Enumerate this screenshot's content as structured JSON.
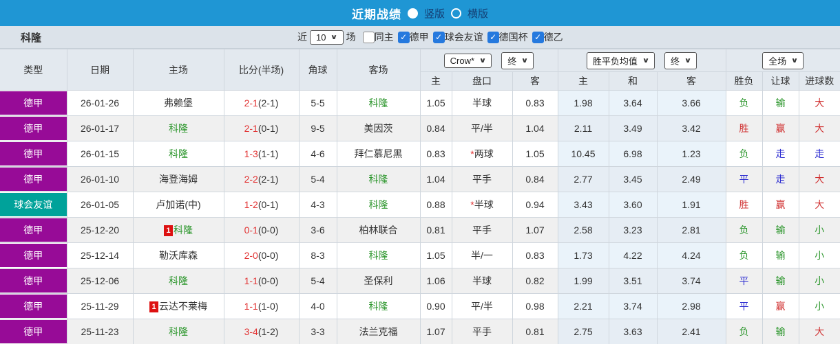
{
  "title_bar": {
    "title": "近期战绩",
    "layout_options": [
      {
        "label": "竖版",
        "selected": true
      },
      {
        "label": "横版",
        "selected": false
      }
    ]
  },
  "team_bar": {
    "team": "科隆",
    "range_prefix": "近",
    "range_value": "10",
    "range_suffix": "场",
    "checkboxes": [
      {
        "label": "同主",
        "checked": false
      },
      {
        "label": "德甲",
        "checked": true
      },
      {
        "label": "球会友谊",
        "checked": true
      },
      {
        "label": "德国杯",
        "checked": true
      },
      {
        "label": "德乙",
        "checked": true
      }
    ]
  },
  "table": {
    "left_columns": [
      "类型",
      "日期",
      "主场",
      "比分(半场)",
      "角球",
      "客场"
    ],
    "selects": {
      "odds_company": "Crow*",
      "odds_state": "终",
      "avg_label": "胜平负均值",
      "avg_state": "终",
      "scope": "全场"
    },
    "sub_columns": [
      "主",
      "盘口",
      "客",
      "主",
      "和",
      "客",
      "胜负",
      "让球",
      "进球数"
    ],
    "rows": [
      {
        "league": "德甲",
        "league_color": "purple",
        "date": "26-01-26",
        "home": {
          "name": "弗赖堡",
          "green": false,
          "card": ""
        },
        "score_ft": "2-1",
        "score_ht": "(2-1)",
        "corner": "5-5",
        "away": {
          "name": "科隆",
          "green": true
        },
        "odds_home": "1.05",
        "handicap": {
          "star": false,
          "text": "半球"
        },
        "odds_away": "0.83",
        "avg": [
          "1.98",
          "3.64",
          "3.66"
        ],
        "results": [
          {
            "text": "负",
            "color": "green"
          },
          {
            "text": "输",
            "color": "green"
          },
          {
            "text": "大",
            "color": "red"
          }
        ]
      },
      {
        "league": "德甲",
        "league_color": "purple",
        "date": "26-01-17",
        "home": {
          "name": "科隆",
          "green": true,
          "card": ""
        },
        "score_ft": "2-1",
        "score_ht": "(0-1)",
        "corner": "9-5",
        "away": {
          "name": "美因茨",
          "green": false
        },
        "odds_home": "0.84",
        "handicap": {
          "star": false,
          "text": "平/半"
        },
        "odds_away": "1.04",
        "avg": [
          "2.11",
          "3.49",
          "3.42"
        ],
        "results": [
          {
            "text": "胜",
            "color": "red"
          },
          {
            "text": "赢",
            "color": "red"
          },
          {
            "text": "大",
            "color": "red"
          }
        ]
      },
      {
        "league": "德甲",
        "league_color": "purple",
        "date": "26-01-15",
        "home": {
          "name": "科隆",
          "green": true,
          "card": ""
        },
        "score_ft": "1-3",
        "score_ht": "(1-1)",
        "corner": "4-6",
        "away": {
          "name": "拜仁慕尼黑",
          "green": false
        },
        "odds_home": "0.83",
        "handicap": {
          "star": true,
          "text": "两球"
        },
        "odds_away": "1.05",
        "avg": [
          "10.45",
          "6.98",
          "1.23"
        ],
        "results": [
          {
            "text": "负",
            "color": "green"
          },
          {
            "text": "走",
            "color": "blue"
          },
          {
            "text": "走",
            "color": "blue"
          }
        ]
      },
      {
        "league": "德甲",
        "league_color": "purple",
        "date": "26-01-10",
        "home": {
          "name": "海登海姆",
          "green": false,
          "card": ""
        },
        "score_ft": "2-2",
        "score_ht": "(2-1)",
        "corner": "5-4",
        "away": {
          "name": "科隆",
          "green": true
        },
        "odds_home": "1.04",
        "handicap": {
          "star": false,
          "text": "平手"
        },
        "odds_away": "0.84",
        "avg": [
          "2.77",
          "3.45",
          "2.49"
        ],
        "results": [
          {
            "text": "平",
            "color": "blue"
          },
          {
            "text": "走",
            "color": "blue"
          },
          {
            "text": "大",
            "color": "red"
          }
        ]
      },
      {
        "league": "球会友谊",
        "league_color": "teal",
        "date": "26-01-05",
        "home": {
          "name": "卢加诺(中)",
          "green": false,
          "card": ""
        },
        "score_ft": "1-2",
        "score_ht": "(0-1)",
        "corner": "4-3",
        "away": {
          "name": "科隆",
          "green": true
        },
        "odds_home": "0.88",
        "handicap": {
          "star": true,
          "text": "半球"
        },
        "odds_away": "0.94",
        "avg": [
          "3.43",
          "3.60",
          "1.91"
        ],
        "results": [
          {
            "text": "胜",
            "color": "red"
          },
          {
            "text": "赢",
            "color": "red"
          },
          {
            "text": "大",
            "color": "red"
          }
        ]
      },
      {
        "league": "德甲",
        "league_color": "purple",
        "date": "25-12-20",
        "home": {
          "name": "科隆",
          "green": true,
          "card": "1"
        },
        "score_ft": "0-1",
        "score_ht": "(0-0)",
        "corner": "3-6",
        "away": {
          "name": "柏林联合",
          "green": false
        },
        "odds_home": "0.81",
        "handicap": {
          "star": false,
          "text": "平手"
        },
        "odds_away": "1.07",
        "avg": [
          "2.58",
          "3.23",
          "2.81"
        ],
        "results": [
          {
            "text": "负",
            "color": "green"
          },
          {
            "text": "输",
            "color": "green"
          },
          {
            "text": "小",
            "color": "green"
          }
        ]
      },
      {
        "league": "德甲",
        "league_color": "purple",
        "date": "25-12-14",
        "home": {
          "name": "勒沃库森",
          "green": false,
          "card": ""
        },
        "score_ft": "2-0",
        "score_ht": "(0-0)",
        "corner": "8-3",
        "away": {
          "name": "科隆",
          "green": true
        },
        "odds_home": "1.05",
        "handicap": {
          "star": false,
          "text": "半/一"
        },
        "odds_away": "0.83",
        "avg": [
          "1.73",
          "4.22",
          "4.24"
        ],
        "results": [
          {
            "text": "负",
            "color": "green"
          },
          {
            "text": "输",
            "color": "green"
          },
          {
            "text": "小",
            "color": "green"
          }
        ]
      },
      {
        "league": "德甲",
        "league_color": "purple",
        "date": "25-12-06",
        "home": {
          "name": "科隆",
          "green": true,
          "card": ""
        },
        "score_ft": "1-1",
        "score_ht": "(0-0)",
        "corner": "5-4",
        "away": {
          "name": "圣保利",
          "green": false
        },
        "odds_home": "1.06",
        "handicap": {
          "star": false,
          "text": "半球"
        },
        "odds_away": "0.82",
        "avg": [
          "1.99",
          "3.51",
          "3.74"
        ],
        "results": [
          {
            "text": "平",
            "color": "blue"
          },
          {
            "text": "输",
            "color": "green"
          },
          {
            "text": "小",
            "color": "green"
          }
        ]
      },
      {
        "league": "德甲",
        "league_color": "purple",
        "date": "25-11-29",
        "home": {
          "name": "云达不莱梅",
          "green": false,
          "card": "1"
        },
        "score_ft": "1-1",
        "score_ht": "(1-0)",
        "corner": "4-0",
        "away": {
          "name": "科隆",
          "green": true
        },
        "odds_home": "0.90",
        "handicap": {
          "star": false,
          "text": "平/半"
        },
        "odds_away": "0.98",
        "avg": [
          "2.21",
          "3.74",
          "2.98"
        ],
        "results": [
          {
            "text": "平",
            "color": "blue"
          },
          {
            "text": "赢",
            "color": "red"
          },
          {
            "text": "小",
            "color": "green"
          }
        ]
      },
      {
        "league": "德甲",
        "league_color": "purple",
        "date": "25-11-23",
        "home": {
          "name": "科隆",
          "green": true,
          "card": ""
        },
        "score_ft": "3-4",
        "score_ht": "(1-2)",
        "corner": "3-3",
        "away": {
          "name": "法兰克福",
          "green": false
        },
        "odds_home": "1.07",
        "handicap": {
          "star": false,
          "text": "平手"
        },
        "odds_away": "0.81",
        "avg": [
          "2.75",
          "3.63",
          "2.41"
        ],
        "results": [
          {
            "text": "负",
            "color": "green"
          },
          {
            "text": "输",
            "color": "green"
          },
          {
            "text": "大",
            "color": "red"
          }
        ]
      }
    ]
  },
  "colors": {
    "title_bar_blue": "#1f96d4",
    "league_purple": "#970b97",
    "league_teal": "#00a29a",
    "team_green": "#2c962c",
    "score_red": "#e23333",
    "result_red": "#d03030",
    "result_blue": "#2a2ad0",
    "checkbox_blue": "#2579de"
  }
}
